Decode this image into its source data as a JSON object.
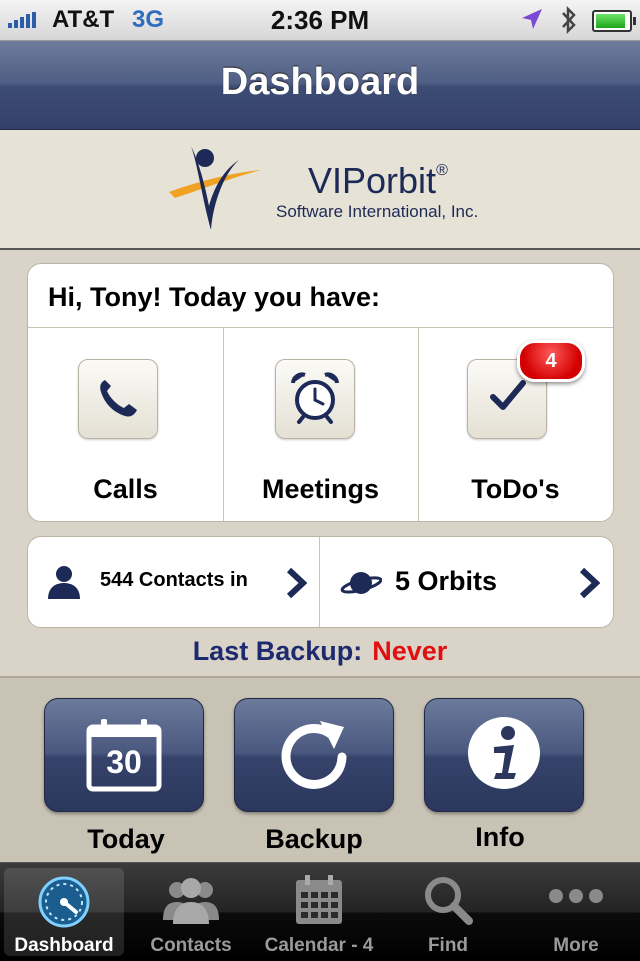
{
  "status_bar": {
    "carrier": "AT&T",
    "network": "3G",
    "time": "2:36 PM",
    "signal_bars": 5,
    "battery_level": 0.9
  },
  "nav": {
    "title": "Dashboard"
  },
  "logo": {
    "name": "VIPorbit",
    "registered": "®",
    "subtitle": "Software International, Inc."
  },
  "today": {
    "greeting": "Hi, Tony! Today you have:",
    "items": [
      {
        "label": "Calls",
        "icon": "phone-icon"
      },
      {
        "label": "Meetings",
        "icon": "alarm-clock-icon"
      },
      {
        "label": "ToDo's",
        "icon": "checkmark-icon",
        "badge": "4"
      }
    ]
  },
  "summary": {
    "contacts_label": "544 Contacts in",
    "orbits_label": "5 Orbits"
  },
  "backup": {
    "label": "Last Backup:",
    "value": "Never",
    "value_color": "#e01010"
  },
  "actions": [
    {
      "label": "Today",
      "icon": "calendar-icon",
      "calendar_day": "30"
    },
    {
      "label": "Backup",
      "icon": "refresh-icon"
    },
    {
      "label": "Info",
      "icon": "info-icon"
    }
  ],
  "tabbar": {
    "tabs": [
      {
        "label": "Dashboard",
        "icon": "speedometer-icon",
        "active": true
      },
      {
        "label": "Contacts",
        "icon": "people-icon"
      },
      {
        "label": "Calendar - 4",
        "icon": "calendar-grid-icon"
      },
      {
        "label": "Find",
        "icon": "magnifier-icon"
      },
      {
        "label": "More",
        "icon": "more-dots-icon"
      }
    ]
  },
  "colors": {
    "nav_blue": "#3d4c74",
    "accent_navy": "#1e2a70",
    "badge_red": "#d30000"
  }
}
